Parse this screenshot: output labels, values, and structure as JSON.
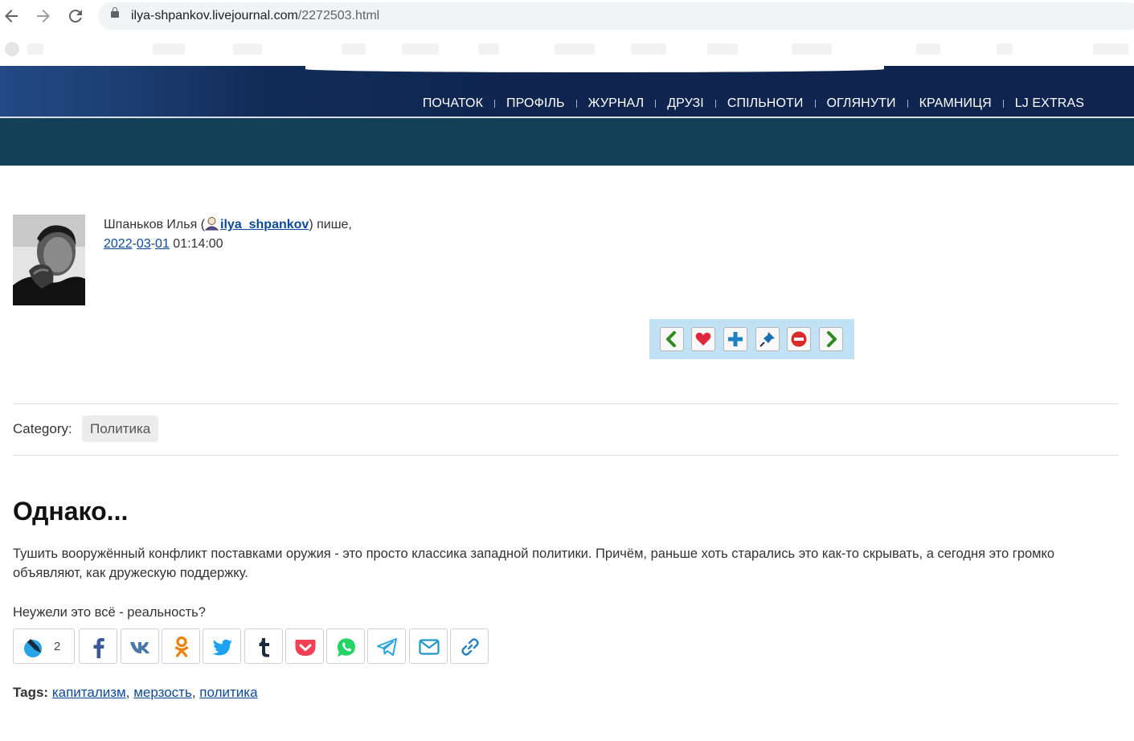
{
  "browser": {
    "url_host": "ilya-shpankov.livejournal.com",
    "url_path": "/2272503.html"
  },
  "nav": {
    "items": [
      "ПОЧАТОК",
      "ПРОФІЛЬ",
      "ЖУРНАЛ",
      "ДРУЗІ",
      "СПІЛЬНОТИ",
      "ОГЛЯНУТИ",
      "КРАМНИЦЯ",
      "LJ EXTRAS"
    ]
  },
  "entry": {
    "author_name": "Шпаньков Илья (",
    "username": "ilya_shpankov",
    "writes": ") пише,",
    "date_year": "2022",
    "date_month": "03",
    "date_day": "01",
    "time": "01:14:00",
    "category_label": "Category:",
    "category": "Политика",
    "title": "Однако...",
    "paragraph1": "Тушить вооружённый конфликт поставками оружия - это просто классика западной политики. Причём, раньше хоть старались это как-то скрывать, а сегодня это громко объявляют, как дружескую поддержку.",
    "paragraph2": "Неужели это всё - реальность?",
    "comment_count": "2",
    "tags_label": "Tags:",
    "tags": [
      "капитализм",
      "мерзость",
      "политика"
    ]
  },
  "toolbar": {
    "icons": [
      "prev-arrow-icon",
      "heart-icon",
      "plus-icon",
      "pin-icon",
      "minus-icon",
      "next-arrow-icon"
    ]
  },
  "share": {
    "icons": [
      "comment-icon",
      "facebook-icon",
      "vk-icon",
      "odnoklassniki-icon",
      "twitter-icon",
      "tumblr-icon",
      "pocket-icon",
      "whatsapp-icon",
      "telegram-icon",
      "email-icon",
      "link-icon"
    ]
  },
  "colors": {
    "header_dark": "#0f2550",
    "header_band": "#114058",
    "link": "#0c4a99",
    "toolbar_bg": "#c1e2f4"
  }
}
